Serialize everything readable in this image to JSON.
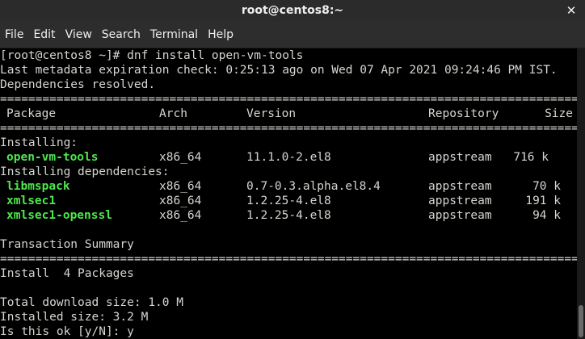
{
  "window": {
    "title": "root@centos8:~",
    "close_glyph": "✕"
  },
  "menu": [
    "File",
    "Edit",
    "View",
    "Search",
    "Terminal",
    "Help"
  ],
  "terminal": {
    "prompt_line": "[root@centos8 ~]# dnf install open-vm-tools",
    "metadata_line": "Last metadata expiration check: 0:25:13 ago on Wed 07 Apr 2021 09:24:46 PM IST.",
    "deps_line": "Dependencies resolved.",
    "rule": "================================================================================================================================",
    "table_headers": {
      "package": "Package",
      "arch": "Arch",
      "version": "Version",
      "repository": "Repository",
      "size": "Size"
    },
    "installing_label": "Installing:",
    "installing_deps_label": "Installing dependencies:",
    "packages": [
      {
        "name": "open-vm-tools",
        "arch": "x86_64",
        "version": "11.1.0-2.el8",
        "repo": "appstream",
        "size": "716 k"
      },
      {
        "name": "libmspack",
        "arch": "x86_64",
        "version": "0.7-0.3.alpha.el8.4",
        "repo": "appstream",
        "size": "70 k"
      },
      {
        "name": "xmlsec1",
        "arch": "x86_64",
        "version": "1.2.25-4.el8",
        "repo": "appstream",
        "size": "191 k"
      },
      {
        "name": "xmlsec1-openssl",
        "arch": "x86_64",
        "version": "1.2.25-4.el8",
        "repo": "appstream",
        "size": "94 k"
      }
    ],
    "transaction_summary": "Transaction Summary",
    "install_line": "Install  4 Packages",
    "download_size": "Total download size: 1.0 M",
    "installed_size": "Installed size: 3.2 M",
    "confirm_prompt": "Is this ok [y/N]: y"
  },
  "colors": {
    "package_name": "#4ee64e",
    "text": "#d3d7cf",
    "background": "#000000",
    "titlebar": "#2b2b2b"
  }
}
